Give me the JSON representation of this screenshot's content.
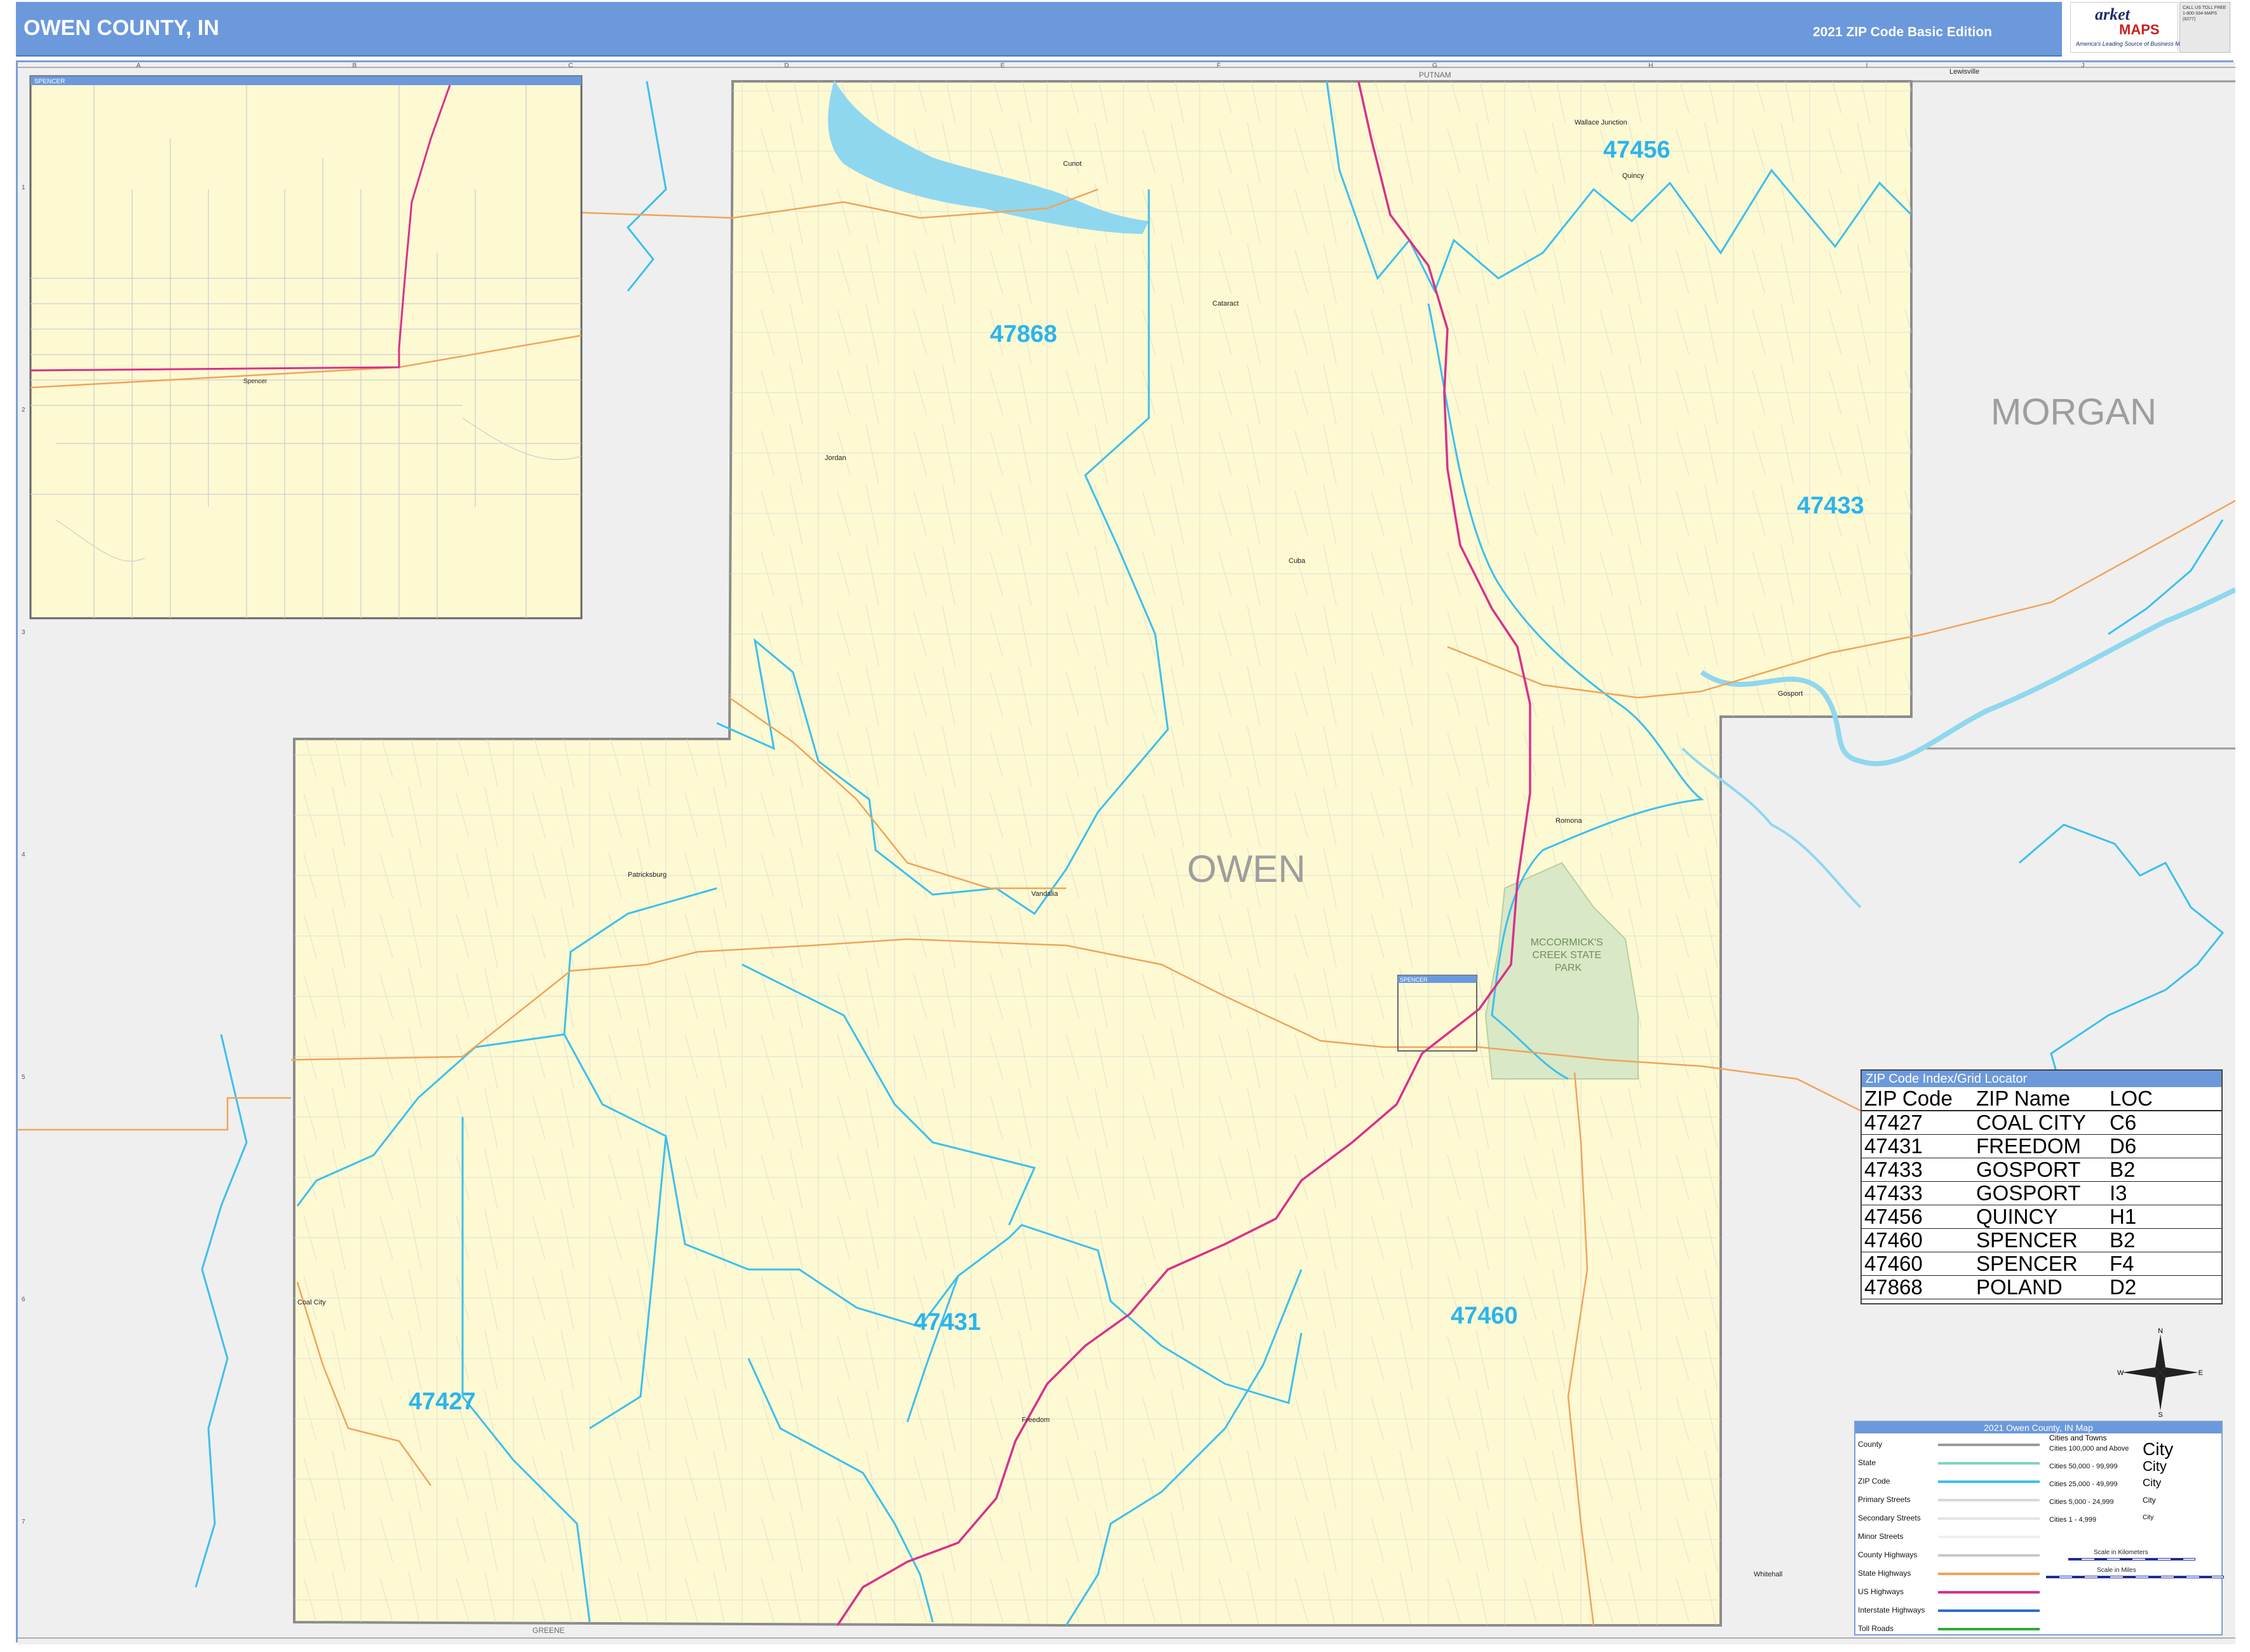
{
  "header": {
    "title": "OWEN COUNTY, IN",
    "edition": "2021 ZIP Code Basic Edition",
    "logo_brand_top": "arket",
    "logo_brand_bottom": "MAPS",
    "logo_tagline": "America's Leading Source of Business Maps",
    "logo_slogan": "On Target. On Time.",
    "logo_contact": "CALL US TOLL FREE 1-800-334-MAPS (6277)"
  },
  "grid": {
    "columns": [
      "A",
      "B",
      "C",
      "D",
      "E",
      "F",
      "G",
      "H",
      "I",
      "J"
    ],
    "rows": [
      "1",
      "2",
      "3",
      "4",
      "5",
      "6",
      "7"
    ]
  },
  "map": {
    "county_label": "OWEN",
    "neighbor_county_label": "MORGAN",
    "park_label": "MCCORMICK'S\nCREEK STATE\nPARK",
    "top_county_label": "PUTNAM",
    "bottom_county_label": "GREENE",
    "zip_labels": [
      {
        "zip": "47456"
      },
      {
        "zip": "47868"
      },
      {
        "zip": "47433"
      },
      {
        "zip": "47431"
      },
      {
        "zip": "47460"
      },
      {
        "zip": "47427"
      }
    ],
    "places": [
      "Wallace Junction",
      "Quincy",
      "Cunot",
      "Cataract",
      "Jordan",
      "Cuba",
      "Gosport",
      "Romona",
      "Patricksburg",
      "Vandalia",
      "Coal City",
      "Freedom",
      "Whitehall",
      "Lewisville"
    ]
  },
  "inset": {
    "title": "SPENCER",
    "city_label": "Spencer",
    "callout_label": "SPENCER"
  },
  "zip_index": {
    "title": "ZIP Code Index/Grid Locator",
    "headers": [
      "ZIP Code",
      "ZIP Name",
      "LOC"
    ],
    "rows": [
      {
        "zip": "47427",
        "name": "COAL CITY",
        "loc": "C6"
      },
      {
        "zip": "47431",
        "name": "FREEDOM",
        "loc": "D6"
      },
      {
        "zip": "47433",
        "name": "GOSPORT",
        "loc": "B2"
      },
      {
        "zip": "47433",
        "name": "GOSPORT",
        "loc": "I3"
      },
      {
        "zip": "47456",
        "name": "QUINCY",
        "loc": "H1"
      },
      {
        "zip": "47460",
        "name": "SPENCER",
        "loc": "B2"
      },
      {
        "zip": "47460",
        "name": "SPENCER",
        "loc": "F4"
      },
      {
        "zip": "47868",
        "name": "POLAND",
        "loc": "D2"
      }
    ]
  },
  "legend": {
    "title": "2021 Owen County, IN Map",
    "line_items": [
      {
        "label": "County",
        "color": "#9a9a9a"
      },
      {
        "label": "State",
        "color": "#7dd7b8"
      },
      {
        "label": "ZIP Code",
        "color": "#3cc0ee"
      },
      {
        "label": "Primary Streets",
        "color": "#d8d8d8"
      },
      {
        "label": "Secondary Streets",
        "color": "#e4e4e4"
      },
      {
        "label": "Minor Streets",
        "color": "#efefef"
      },
      {
        "label": "County Highways",
        "color": "#c9c9c9"
      },
      {
        "label": "State Highways",
        "color": "#f0a35a"
      },
      {
        "label": "US Highways",
        "color": "#d8318c"
      },
      {
        "label": "Interstate Highways",
        "color": "#2a6fcf"
      },
      {
        "label": "Toll Roads",
        "color": "#2fa83a"
      }
    ],
    "cities_heading": "Cities and Towns",
    "city_items": [
      {
        "label": "Cities 100,000 and Above",
        "sample": "City"
      },
      {
        "label": "Cities 50,000 - 99,999",
        "sample": "City"
      },
      {
        "label": "Cities 25,000 - 49,999",
        "sample": "City"
      },
      {
        "label": "Cities 5,000 - 24,999",
        "sample": "City"
      },
      {
        "label": "Cities 1 - 4,999",
        "sample": "City"
      }
    ],
    "scale_km_label": "Scale in Kilometers",
    "scale_mi_label": "Scale in Miles"
  },
  "compass": {
    "n": "N",
    "s": "S",
    "e": "E",
    "w": "W"
  },
  "colors": {
    "header_bg": "#6b99dc",
    "county_fill": "#fdf9d2",
    "outside_fill": "#efefef",
    "zip_line": "#3cc0ee",
    "zip_label": "#2ab4ee",
    "us_highway": "#d8318c",
    "state_highway": "#f0a35a",
    "water": "#8fd7ef",
    "park": "#d9e8c7"
  }
}
